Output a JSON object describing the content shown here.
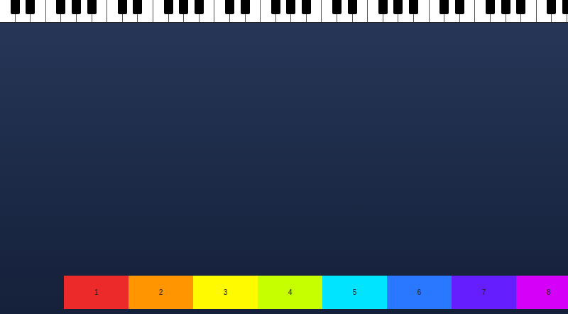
{
  "boxes": [
    {
      "label": "1",
      "color": "#ec2a2a"
    },
    {
      "label": "2",
      "color": "#ff9500"
    },
    {
      "label": "3",
      "color": "#fffa00"
    },
    {
      "label": "4",
      "color": "#c6ff00"
    },
    {
      "label": "5",
      "color": "#00e4ff"
    },
    {
      "label": "6",
      "color": "#2a78ff"
    },
    {
      "label": "7",
      "color": "#651fff"
    },
    {
      "label": "8",
      "color": "#d400f8"
    }
  ]
}
